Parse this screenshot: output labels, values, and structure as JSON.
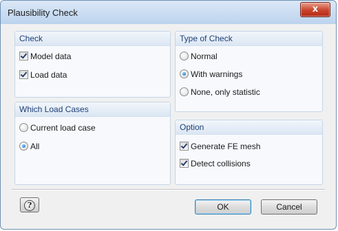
{
  "window": {
    "title": "Plausibility Check",
    "close_label": "x"
  },
  "check_group": {
    "title": "Check",
    "items": [
      {
        "label": "Model data",
        "checked": true
      },
      {
        "label": "Load data",
        "checked": true
      }
    ]
  },
  "type_group": {
    "title": "Type of Check",
    "items": [
      {
        "label": "Normal",
        "selected": false
      },
      {
        "label": "With warnings",
        "selected": true
      },
      {
        "label": "None, only statistic",
        "selected": false
      }
    ]
  },
  "load_cases_group": {
    "title": "Which Load Cases",
    "items": [
      {
        "label": "Current load case",
        "selected": false
      },
      {
        "label": "All",
        "selected": true
      }
    ]
  },
  "option_group": {
    "title": "Option",
    "items": [
      {
        "label": "Generate FE mesh",
        "checked": true
      },
      {
        "label": "Detect collisions",
        "checked": true
      }
    ]
  },
  "footer": {
    "help_label": "?",
    "ok_label": "OK",
    "cancel_label": "Cancel"
  },
  "colors": {
    "title_bar": "#bcd3ee",
    "group_title": "#1e3f76",
    "close_button": "#c9432c"
  }
}
